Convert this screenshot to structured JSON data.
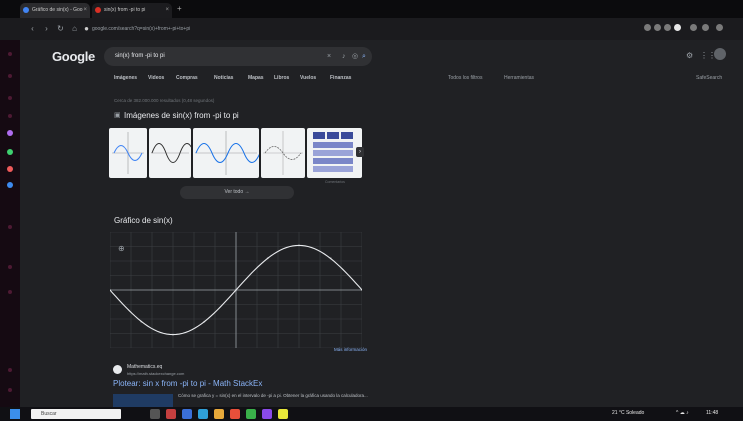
{
  "browser": {
    "tabs": [
      {
        "label": "Gráfico de sin(x) - Goo"
      },
      {
        "label": "sin(x) from -pi to pi"
      }
    ],
    "url": "google.com/search?q=sin(x)+from+-pi+to+pi"
  },
  "google": {
    "logo": "Google",
    "query": "sin(x) from -pi to pi",
    "tabs": [
      "Imágenes",
      "Videos",
      "Compras",
      "Noticias",
      "Mapas",
      "Libros",
      "Vuelos",
      "Finanzas"
    ],
    "tools": "Todos los filtros",
    "tools2": "Herramientas",
    "safe": "SafeSearch",
    "stats": "Cerca de 382.000.000 resultados (0,48 segundos)"
  },
  "images": {
    "title": "Imágenes de sin(x) from -pi to pi",
    "more": "Ver todo"
  },
  "graph": {
    "title": "Gráfico de sin(x)",
    "more": "Más información"
  },
  "result": {
    "site": "Mathematics.eq",
    "url": "https://math.stackexchange.com",
    "title": "Plotear: sin x from -pi to pi  - Math StackEx",
    "snippet": "Cómo se grafica y = sin(x) en el intervalo de -pi a pi. Obtener la gráfica usando la calculadora..."
  },
  "taskbar": {
    "search": "Buscar",
    "weather": "21 °C Soleado",
    "time": "11:48"
  },
  "chart_data": {
    "type": "line",
    "title": "Gráfico de sin(x)",
    "xlabel": "",
    "ylabel": "",
    "xlim": [
      -3.14,
      3.14
    ],
    "ylim": [
      -1.3,
      1.3
    ],
    "grid": true,
    "series": [
      {
        "x": [
          -3.14,
          -2.36,
          -1.57,
          -0.79,
          0,
          0.79,
          1.57,
          2.36,
          3.14
        ],
        "y": [
          0,
          -0.71,
          -1,
          -0.71,
          0,
          0.71,
          1,
          0.71,
          0
        ]
      }
    ]
  }
}
